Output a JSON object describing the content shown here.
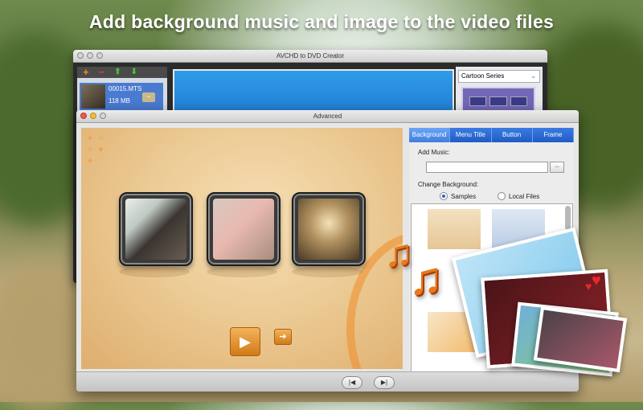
{
  "headline": "Add background music and image to the video files",
  "back_window": {
    "title": "AVCHD to DVD Creator",
    "file_list": [
      {
        "name": "00015.MTS",
        "size": "118 MB"
      }
    ],
    "toolbar": {
      "add": "+",
      "remove": "−",
      "up": "⬆",
      "down": "⬇"
    },
    "menu_series": "Cartoon Series"
  },
  "front_window": {
    "title": "Advanced",
    "tabs": [
      "Background",
      "Menu Title",
      "Button",
      "Frame"
    ],
    "add_music_label": "Add Music:",
    "music_path": "",
    "browse_label": "...",
    "change_bg_label": "Change Background:",
    "radio_samples": "Samples",
    "radio_local": "Local Files"
  },
  "icons": {
    "play": "▶",
    "next": "➔",
    "prev_nav": "|◀",
    "next_nav": "▶|",
    "music_note": "♫",
    "heart": "♥"
  },
  "colors": {
    "tab_active": "#3e7ee0",
    "accent_orange": "#e8781a"
  }
}
